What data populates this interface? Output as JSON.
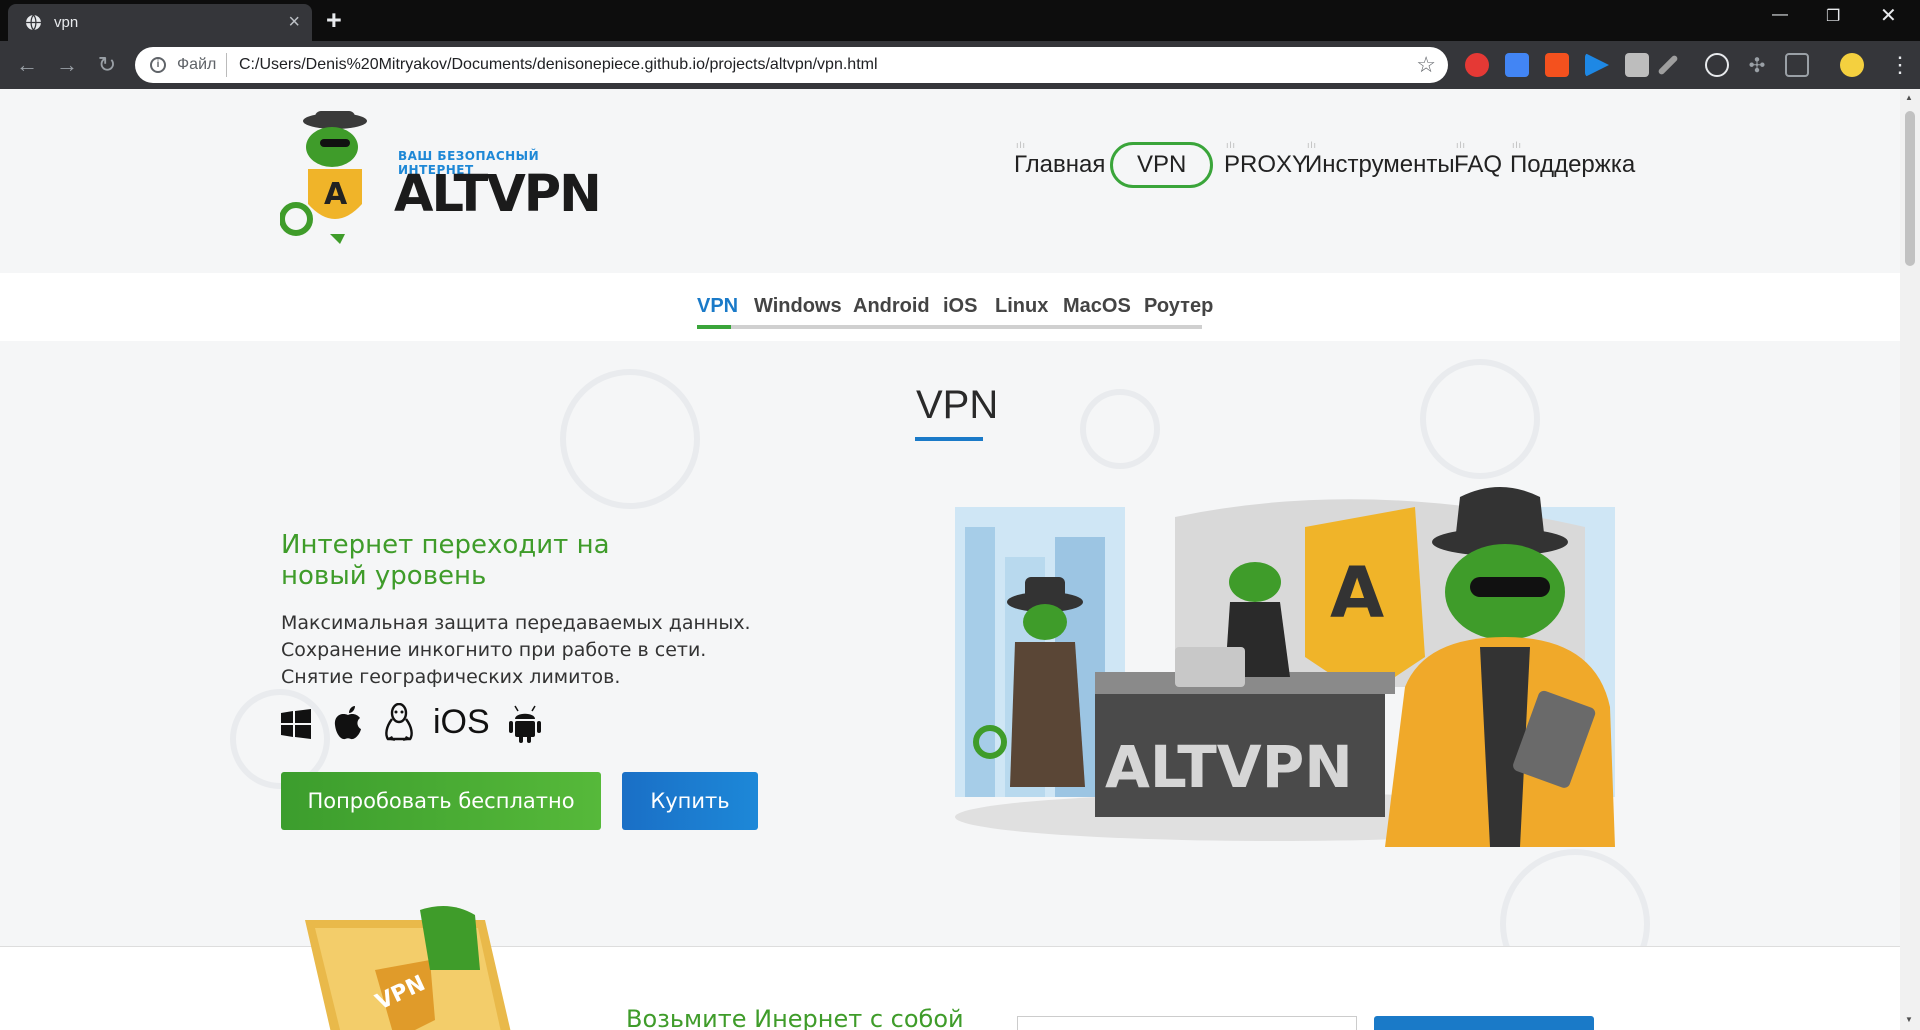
{
  "browser": {
    "tab_title": "vpn",
    "scheme_label": "Файл",
    "url": "C:/Users/Denis%20Mitryakov/Documents/denisonepiece.github.io/projects/altvpn/vpn.html",
    "icons": [
      "globe-icon",
      "close-icon",
      "plus-icon",
      "back-icon",
      "forward-icon",
      "reload-icon",
      "info-icon",
      "star-icon"
    ]
  },
  "header": {
    "tagline": "ВАШ БЕЗОПАСНЫЙ ИНТЕРНЕТ",
    "brand": "ALTVPN",
    "nav": [
      {
        "label": "Главная"
      },
      {
        "label": "VPN"
      },
      {
        "label": "PROXY"
      },
      {
        "label": "Инструменты"
      },
      {
        "label": "FAQ"
      },
      {
        "label": "Поддержка"
      }
    ]
  },
  "subnav": {
    "tabs": [
      {
        "label": "VPN"
      },
      {
        "label": "Windows"
      },
      {
        "label": "Android"
      },
      {
        "label": "iOS"
      },
      {
        "label": "Linux"
      },
      {
        "label": "MacOS"
      },
      {
        "label": "Роутер"
      }
    ]
  },
  "main": {
    "title": "VPN",
    "heading": "Интернет переходит на новый уровень",
    "lines": [
      "Максимальная защита передаваемых данных.",
      "Сохранение инкогнито при работе в сети.",
      "Снятие географических лимитов."
    ],
    "os_label": "iOS",
    "try_button": "Попробовать бесплатно",
    "buy_button": "Купить",
    "illustration_sign": "ALTVPN"
  },
  "section2": {
    "heading": "Возьмите Инернет с собой"
  },
  "colors": {
    "accent_green": "#3f9c2a",
    "accent_blue": "#1a7ac8",
    "chrome_dark": "#35363a"
  }
}
